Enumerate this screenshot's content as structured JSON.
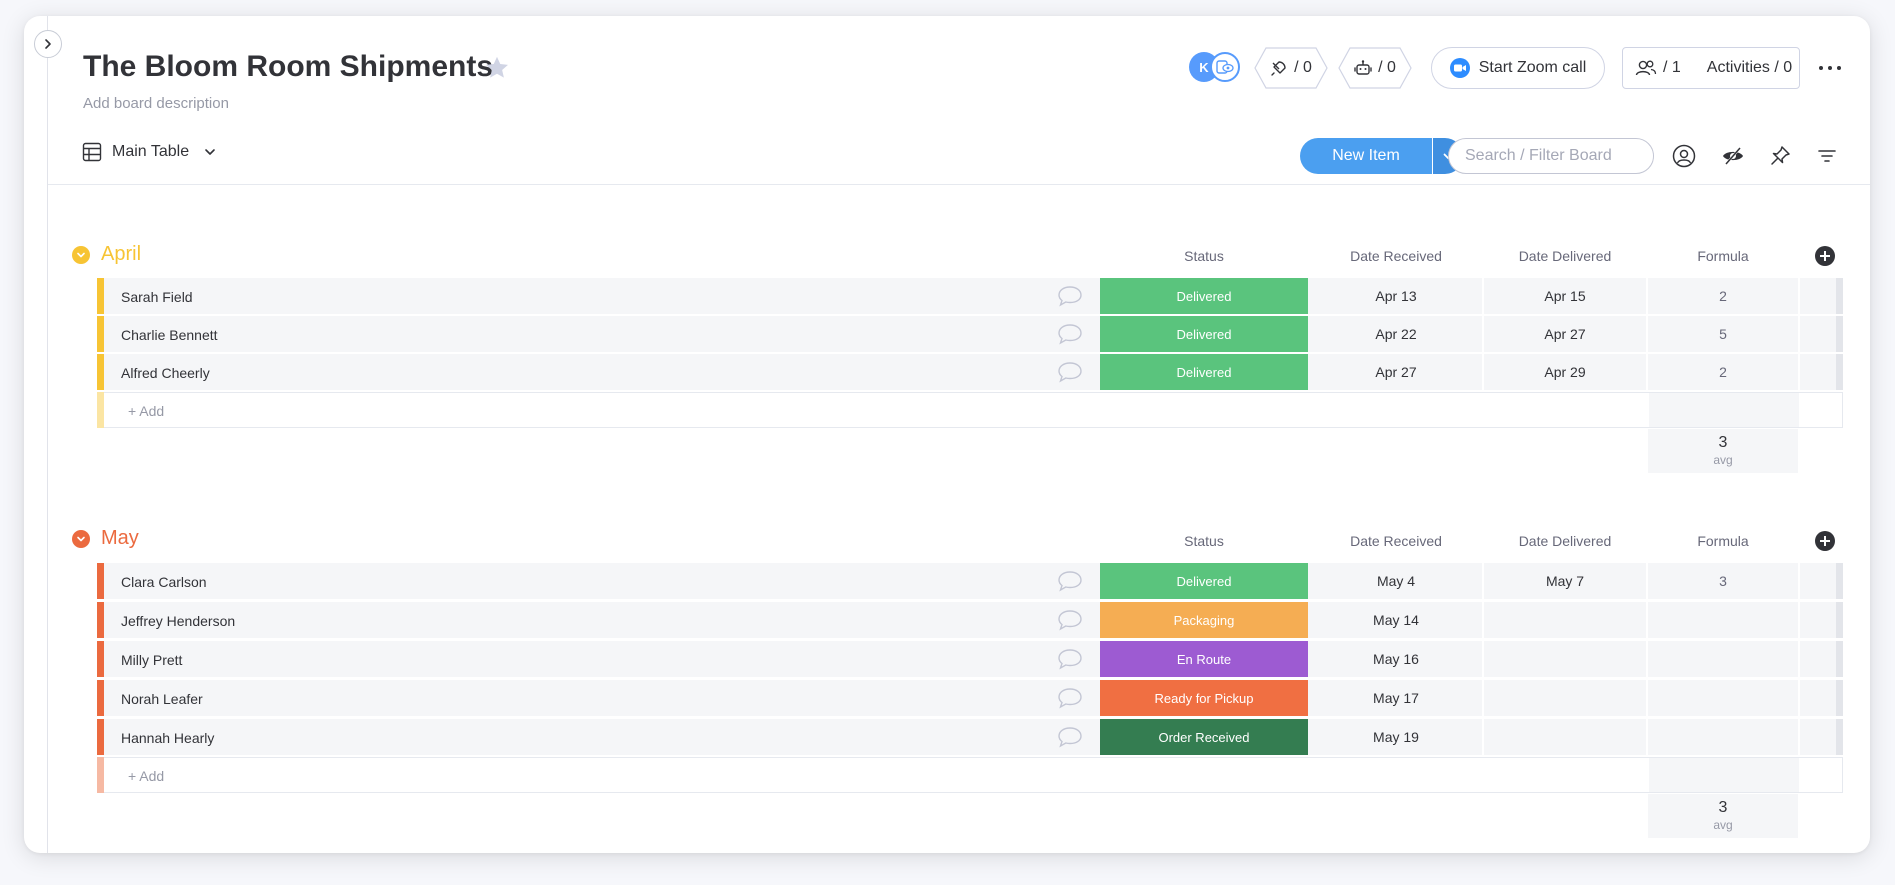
{
  "board": {
    "title": "The Bloom Room Shipments",
    "description": "Add board description"
  },
  "header": {
    "avatar_letter": "K",
    "updates_count": "/ 0",
    "automations_count": "/ 0",
    "zoom_label": "Start Zoom call",
    "members_count": "/ 1",
    "activities_label": "Activities / 0"
  },
  "toolbar": {
    "view_label": "Main Table",
    "new_item_label": "New Item",
    "search_placeholder": "Search / Filter Board"
  },
  "columns": [
    "Status",
    "Date Received",
    "Date Delivered",
    "Formula"
  ],
  "colors": {
    "delivered": "#5ac47d",
    "packaging": "#f5ad53",
    "en_route": "#9d5bd2",
    "ready_for_pickup": "#f06f42",
    "order_received": "#347d51",
    "april": "#f7c434",
    "may": "#eb6a3f"
  },
  "groups": [
    {
      "name": "April",
      "color": "#f7c434",
      "items": [
        {
          "name": "Sarah Field",
          "status": "Delivered",
          "status_color": "#5ac47d",
          "date_received": "Apr 13",
          "date_delivered": "Apr 15",
          "formula": "2"
        },
        {
          "name": "Charlie Bennett",
          "status": "Delivered",
          "status_color": "#5ac47d",
          "date_received": "Apr 22",
          "date_delivered": "Apr 27",
          "formula": "5"
        },
        {
          "name": "Alfred Cheerly",
          "status": "Delivered",
          "status_color": "#5ac47d",
          "date_received": "Apr 27",
          "date_delivered": "Apr 29",
          "formula": "2"
        }
      ],
      "add_label": "+ Add",
      "summary_value": "3",
      "summary_unit": "avg"
    },
    {
      "name": "May",
      "color": "#eb6a3f",
      "items": [
        {
          "name": "Clara Carlson",
          "status": "Delivered",
          "status_color": "#5ac47d",
          "date_received": "May 4",
          "date_delivered": "May 7",
          "formula": "3"
        },
        {
          "name": "Jeffrey Henderson",
          "status": "Packaging",
          "status_color": "#f5ad53",
          "date_received": "May 14",
          "date_delivered": "",
          "formula": ""
        },
        {
          "name": "Milly Prett",
          "status": "En Route",
          "status_color": "#9d5bd2",
          "date_received": "May 16",
          "date_delivered": "",
          "formula": ""
        },
        {
          "name": "Norah Leafer",
          "status": "Ready for Pickup",
          "status_color": "#f06f42",
          "date_received": "May 17",
          "date_delivered": "",
          "formula": ""
        },
        {
          "name": "Hannah Hearly",
          "status": "Order Received",
          "status_color": "#347d51",
          "date_received": "May 19",
          "date_delivered": "",
          "formula": ""
        }
      ],
      "add_label": "+ Add",
      "summary_value": "3",
      "summary_unit": "avg"
    }
  ]
}
